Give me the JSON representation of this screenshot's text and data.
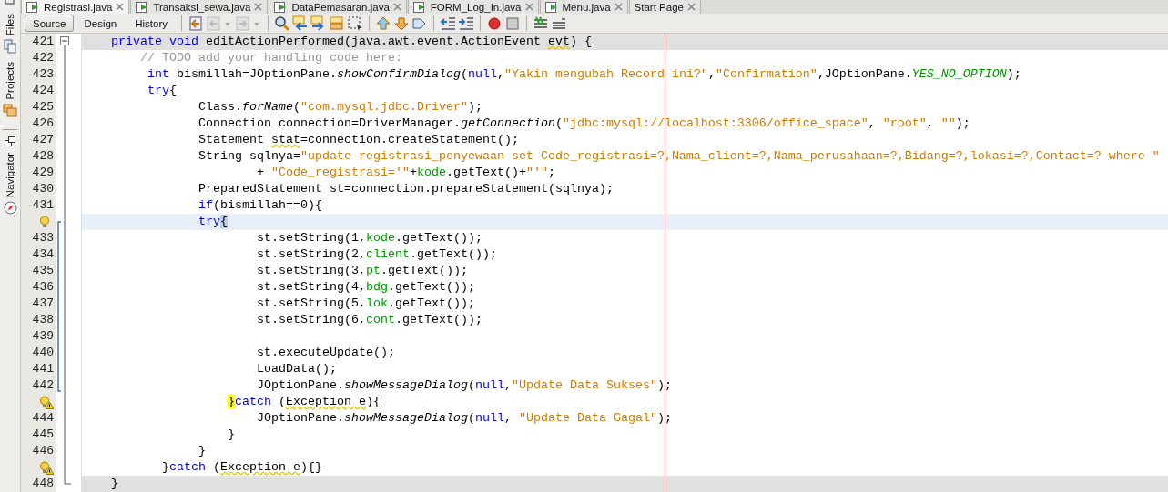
{
  "sidebar_tabs": [
    {
      "label": "Files"
    },
    {
      "label": "Projects"
    },
    {
      "label": "Navigator"
    }
  ],
  "editor_tabs": [
    {
      "label": "Registrasi.java",
      "selected": true,
      "kind": "java"
    },
    {
      "label": "Transaksi_sewa.java",
      "selected": false,
      "kind": "java"
    },
    {
      "label": "DataPemasaran.java",
      "selected": false,
      "kind": "java"
    },
    {
      "label": "FORM_Log_In.java",
      "selected": false,
      "kind": "java"
    },
    {
      "label": "Menu.java",
      "selected": false,
      "kind": "java"
    },
    {
      "label": "Start Page",
      "selected": false,
      "kind": "page"
    }
  ],
  "view_buttons": [
    {
      "label": "Source",
      "selected": true
    },
    {
      "label": "Design",
      "selected": false
    },
    {
      "label": "History",
      "selected": false
    }
  ],
  "toolbar_icons": [
    {
      "kind": "last-edit",
      "disabled": false
    },
    {
      "kind": "back",
      "disabled": true
    },
    {
      "kind": "forward",
      "disabled": true
    },
    {
      "kind": "sep"
    },
    {
      "kind": "find",
      "disabled": false
    },
    {
      "kind": "find-prev",
      "disabled": false
    },
    {
      "kind": "find-next",
      "disabled": false
    },
    {
      "kind": "highlight",
      "disabled": false
    },
    {
      "kind": "find-selection",
      "disabled": false
    },
    {
      "kind": "sep"
    },
    {
      "kind": "bookmark-prev",
      "disabled": false
    },
    {
      "kind": "bookmark-next",
      "disabled": false
    },
    {
      "kind": "bookmark-toggle",
      "disabled": false
    },
    {
      "kind": "sep"
    },
    {
      "kind": "shift-left",
      "disabled": false
    },
    {
      "kind": "shift-right",
      "disabled": false
    },
    {
      "kind": "sep"
    },
    {
      "kind": "record",
      "disabled": false
    },
    {
      "kind": "stop",
      "disabled": false
    },
    {
      "kind": "sep"
    },
    {
      "kind": "comment",
      "disabled": false
    },
    {
      "kind": "uncomment",
      "disabled": false
    }
  ],
  "code_lines": [
    {
      "number": "421",
      "kind": "fold",
      "tokens": [
        {
          "kind": "keyword",
          "text": "    private"
        },
        {
          "kind": "keyword",
          "text": " void"
        },
        {
          "kind": "plain",
          "text": " editActionPerformed(java.awt.event.ActionEvent "
        },
        {
          "kind": "warning",
          "text": "evt"
        },
        {
          "kind": "plain",
          "text": ") {"
        }
      ]
    },
    {
      "number": "422",
      "kind": "plain",
      "tokens": [
        {
          "kind": "comment",
          "text": "        // TODO add your handling code here:"
        }
      ]
    },
    {
      "number": "423",
      "kind": "plain",
      "tokens": [
        {
          "kind": "keyword",
          "text": "         int"
        },
        {
          "kind": "plain",
          "text": " bismillah=JOptionPane."
        },
        {
          "kind": "method",
          "text": "showConfirmDialog"
        },
        {
          "kind": "plain",
          "text": "("
        },
        {
          "kind": "keyword",
          "text": "null"
        },
        {
          "kind": "plain",
          "text": ","
        },
        {
          "kind": "string",
          "text": "\"Yakin mengubah Record ini?\""
        },
        {
          "kind": "plain",
          "text": ","
        },
        {
          "kind": "string",
          "text": "\"Confirmation\""
        },
        {
          "kind": "plain",
          "text": ",JOptionPane."
        },
        {
          "kind": "constant",
          "text": "YES_NO_OPTION"
        },
        {
          "kind": "plain",
          "text": ");"
        }
      ]
    },
    {
      "number": "424",
      "kind": "plain",
      "tokens": [
        {
          "kind": "keyword",
          "text": "         try"
        },
        {
          "kind": "plain",
          "text": "{"
        }
      ]
    },
    {
      "number": "425",
      "kind": "plain",
      "tokens": [
        {
          "kind": "plain",
          "text": "                Class."
        },
        {
          "kind": "method",
          "text": "forName"
        },
        {
          "kind": "plain",
          "text": "("
        },
        {
          "kind": "string",
          "text": "\"com.mysql.jdbc.Driver\""
        },
        {
          "kind": "plain",
          "text": ");"
        }
      ]
    },
    {
      "number": "426",
      "kind": "plain",
      "tokens": [
        {
          "kind": "plain",
          "text": "                Connection connection=DriverManager."
        },
        {
          "kind": "method",
          "text": "getConnection"
        },
        {
          "kind": "plain",
          "text": "("
        },
        {
          "kind": "string",
          "text": "\"jdbc:mysql://localhost:3306/office_space\""
        },
        {
          "kind": "plain",
          "text": ", "
        },
        {
          "kind": "string",
          "text": "\"root\""
        },
        {
          "kind": "plain",
          "text": ", "
        },
        {
          "kind": "string",
          "text": "\"\""
        },
        {
          "kind": "plain",
          "text": ");"
        }
      ]
    },
    {
      "number": "427",
      "kind": "plain",
      "tokens": [
        {
          "kind": "plain",
          "text": "                Statement "
        },
        {
          "kind": "warning",
          "text": "stat"
        },
        {
          "kind": "plain",
          "text": "=connection.createStatement();"
        }
      ]
    },
    {
      "number": "428",
      "kind": "plain",
      "tokens": [
        {
          "kind": "plain",
          "text": "                String sqlnya="
        },
        {
          "kind": "string",
          "text": "\"update registrasi_penyewaan set Code_registrasi=?,Nama_client=?,Nama_perusahaan=?,Bidang=?,lokasi=?,Contact=? where \""
        }
      ]
    },
    {
      "number": "429",
      "kind": "plain",
      "tokens": [
        {
          "kind": "plain",
          "text": "                        + "
        },
        {
          "kind": "string",
          "text": "\"Code_registrasi='\""
        },
        {
          "kind": "plain",
          "text": "+"
        },
        {
          "kind": "field",
          "text": "kode"
        },
        {
          "kind": "plain",
          "text": ".getText()+"
        },
        {
          "kind": "string",
          "text": "\"'\""
        },
        {
          "kind": "plain",
          "text": ";"
        }
      ]
    },
    {
      "number": "430",
      "kind": "plain",
      "tokens": [
        {
          "kind": "plain",
          "text": "                PreparedStatement st=connection.prepareStatement(sqlnya);"
        }
      ]
    },
    {
      "number": "431",
      "kind": "plain",
      "tokens": [
        {
          "kind": "keyword",
          "text": "                if"
        },
        {
          "kind": "plain",
          "text": "(bismillah==0){"
        }
      ]
    },
    {
      "gutter_icon": {
        "kind": "bulb"
      },
      "kind": "current",
      "tokens": [
        {
          "kind": "keyword",
          "text": "                try"
        },
        {
          "kind": "caret-bracket",
          "text": "{"
        }
      ]
    },
    {
      "number": "433",
      "kind": "plain",
      "tokens": [
        {
          "kind": "plain",
          "text": "                        st.setString(1,"
        },
        {
          "kind": "field",
          "text": "kode"
        },
        {
          "kind": "plain",
          "text": ".getText());"
        }
      ]
    },
    {
      "number": "434",
      "kind": "plain",
      "tokens": [
        {
          "kind": "plain",
          "text": "                        st.setString(2,"
        },
        {
          "kind": "field",
          "text": "client"
        },
        {
          "kind": "plain",
          "text": ".getText());"
        }
      ]
    },
    {
      "number": "435",
      "kind": "plain",
      "tokens": [
        {
          "kind": "plain",
          "text": "                        st.setString(3,"
        },
        {
          "kind": "field",
          "text": "pt"
        },
        {
          "kind": "plain",
          "text": ".getText());"
        }
      ]
    },
    {
      "number": "436",
      "kind": "plain",
      "tokens": [
        {
          "kind": "plain",
          "text": "                        st.setString(4,"
        },
        {
          "kind": "field",
          "text": "bdg"
        },
        {
          "kind": "plain",
          "text": ".getText());"
        }
      ]
    },
    {
      "number": "437",
      "kind": "plain",
      "tokens": [
        {
          "kind": "plain",
          "text": "                        st.setString(5,"
        },
        {
          "kind": "field",
          "text": "lok"
        },
        {
          "kind": "plain",
          "text": ".getText());"
        }
      ]
    },
    {
      "number": "438",
      "kind": "plain",
      "tokens": [
        {
          "kind": "plain",
          "text": "                        st.setString(6,"
        },
        {
          "kind": "field",
          "text": "cont"
        },
        {
          "kind": "plain",
          "text": ".getText());"
        }
      ]
    },
    {
      "number": "439",
      "kind": "plain"
    },
    {
      "number": "440",
      "kind": "plain",
      "tokens": [
        {
          "kind": "plain",
          "text": "                        st.executeUpdate();"
        }
      ]
    },
    {
      "number": "441",
      "kind": "plain",
      "tokens": [
        {
          "kind": "plain",
          "text": "                        LoadData();"
        }
      ]
    },
    {
      "number": "442",
      "kind": "plain",
      "tokens": [
        {
          "kind": "plain",
          "text": "                        JOptionPane."
        },
        {
          "kind": "method",
          "text": "showMessageDialog"
        },
        {
          "kind": "plain",
          "text": "("
        },
        {
          "kind": "keyword",
          "text": "null"
        },
        {
          "kind": "plain",
          "text": ","
        },
        {
          "kind": "string",
          "text": "\"Update Data Sukses\""
        },
        {
          "kind": "plain",
          "text": ");"
        }
      ]
    },
    {
      "gutter_icon": {
        "kind": "bulb-warning"
      },
      "kind": "plain",
      "tokens": [
        {
          "kind": "matched-bracket",
          "text": "                    }"
        },
        {
          "kind": "keyword",
          "text": "catch"
        },
        {
          "kind": "plain",
          "text": " ("
        },
        {
          "kind": "warning",
          "text": "Exception e"
        },
        {
          "kind": "plain",
          "text": "){"
        }
      ]
    },
    {
      "number": "444",
      "kind": "plain",
      "tokens": [
        {
          "kind": "plain",
          "text": "                        JOptionPane."
        },
        {
          "kind": "method",
          "text": "showMessageDialog"
        },
        {
          "kind": "plain",
          "text": "("
        },
        {
          "kind": "keyword",
          "text": "null"
        },
        {
          "kind": "plain",
          "text": ", "
        },
        {
          "kind": "string",
          "text": "\"Update Data Gagal\""
        },
        {
          "kind": "plain",
          "text": ");"
        }
      ]
    },
    {
      "number": "445",
      "kind": "plain",
      "tokens": [
        {
          "kind": "plain",
          "text": "                    }"
        }
      ]
    },
    {
      "number": "446",
      "kind": "plain",
      "tokens": [
        {
          "kind": "plain",
          "text": "                }"
        }
      ]
    },
    {
      "gutter_icon": {
        "kind": "bulb-warning"
      },
      "kind": "plain",
      "tokens": [
        {
          "kind": "plain",
          "text": "           }"
        },
        {
          "kind": "keyword",
          "text": "catch"
        },
        {
          "kind": "plain",
          "text": " ("
        },
        {
          "kind": "warning",
          "text": "Exception e"
        },
        {
          "kind": "plain",
          "text": "){}"
        }
      ]
    },
    {
      "number": "448",
      "kind": "fold",
      "tokens": [
        {
          "kind": "plain",
          "text": "    }"
        }
      ]
    }
  ]
}
